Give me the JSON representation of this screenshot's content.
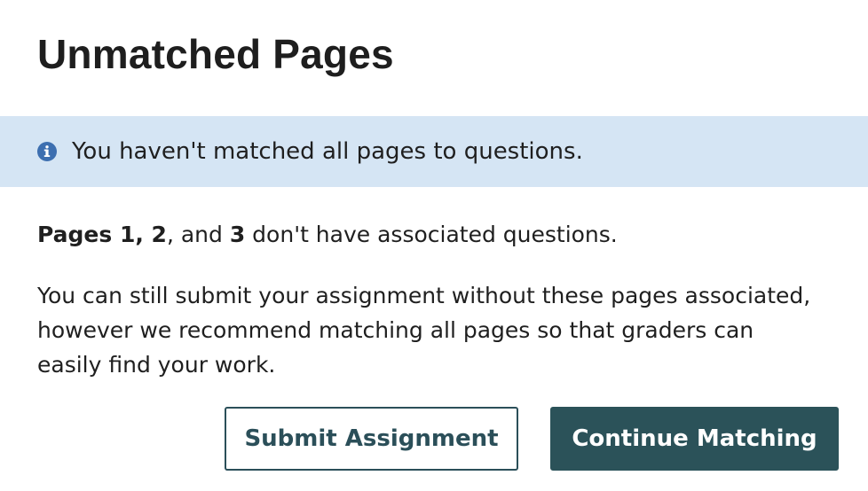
{
  "dialog": {
    "title": "Unmatched Pages"
  },
  "alert": {
    "icon": "info-icon",
    "message": "You haven't matched all pages to questions."
  },
  "pages_notice": {
    "lead": "Pages 1, 2",
    "separator": ", and ",
    "last": "3",
    "tail": " don't have associated questions."
  },
  "explanation": "You can still submit your assignment without these pages associated, however we recommend matching all pages so that graders can easily find your work.",
  "buttons": {
    "submit_label": "Submit Assignment",
    "continue_label": "Continue Matching"
  },
  "colors": {
    "alert_background": "#d5e5f4",
    "info_icon": "#3d6fb0",
    "primary_button": "#2b5259",
    "secondary_border": "#2b4f59"
  }
}
